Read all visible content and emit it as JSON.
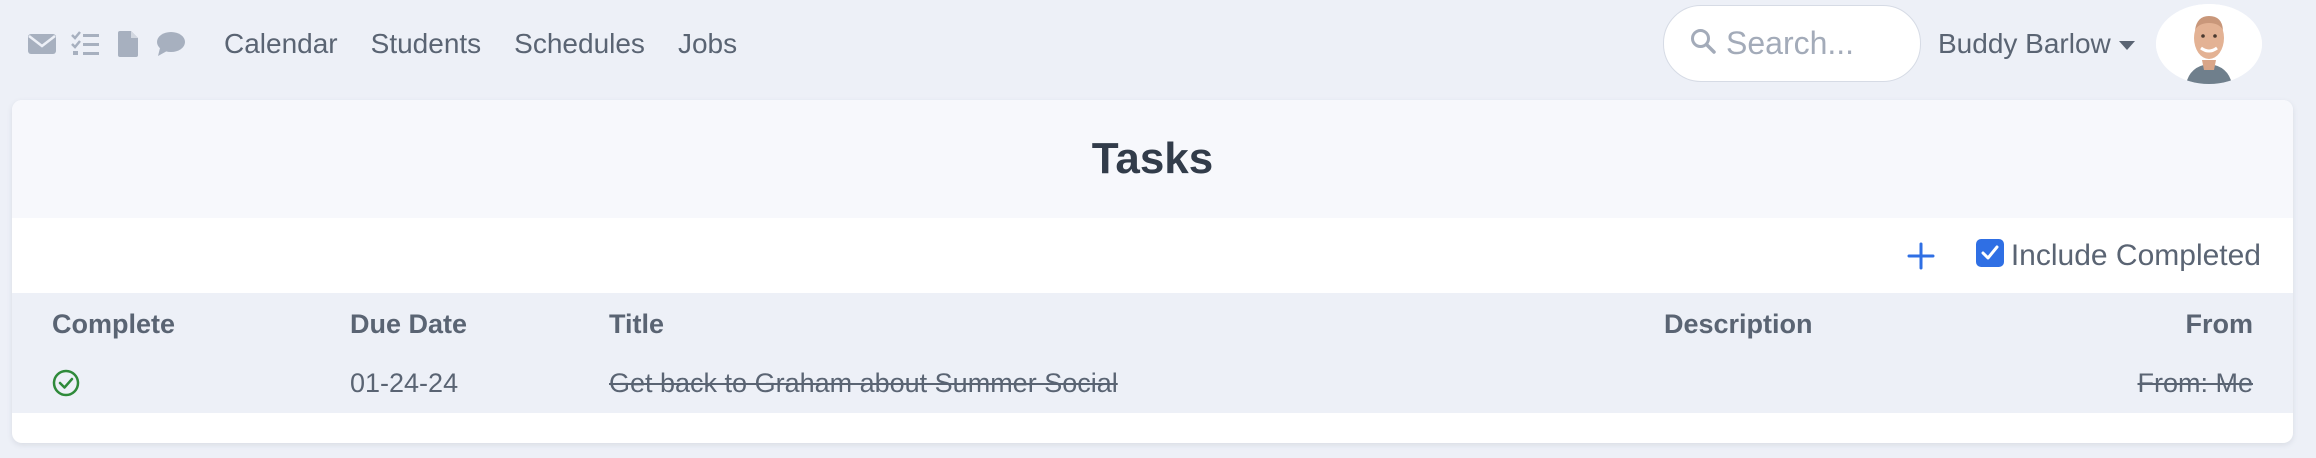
{
  "nav": {
    "icons": [
      "envelope-icon",
      "tasks-icon",
      "file-icon",
      "comment-icon"
    ],
    "links": [
      "Calendar",
      "Students",
      "Schedules",
      "Jobs"
    ],
    "search_placeholder": "Search...",
    "user_name": "Buddy Barlow"
  },
  "page": {
    "title": "Tasks",
    "include_completed_label": "Include Completed",
    "include_completed_checked": true
  },
  "table": {
    "headers": {
      "complete": "Complete",
      "due_date": "Due Date",
      "title": "Title",
      "description": "Description",
      "from": "From"
    },
    "rows": [
      {
        "completed": true,
        "due_date": "01-24-24",
        "title": "Get back to Graham about Summer Social",
        "description": "",
        "from": "From: Me"
      }
    ]
  },
  "colors": {
    "accent": "#2f6fe4",
    "complete_green": "#2f8a3a",
    "background": "#edf0f7"
  }
}
